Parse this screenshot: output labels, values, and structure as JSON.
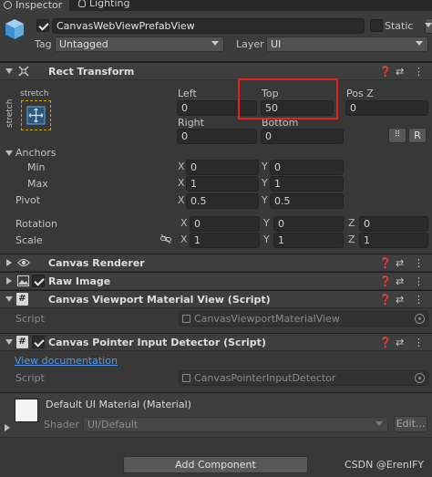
{
  "tabs": [
    {
      "label": "Inspector",
      "icon": "info-icon",
      "active": true
    },
    {
      "label": "Lighting",
      "icon": "bulb-icon",
      "active": false
    }
  ],
  "gameobject": {
    "active": true,
    "name": "CanvasWebViewPrefabView",
    "static_label": "Static",
    "tag_label": "Tag",
    "tag_value": "Untagged",
    "layer_label": "Layer",
    "layer_value": "UI"
  },
  "rect_transform": {
    "title": "Rect Transform",
    "stretch_top": "stretch",
    "stretch_side": "stretch",
    "left_label": "Left",
    "left_value": "0",
    "top_label": "Top",
    "top_value": "50",
    "posz_label": "Pos Z",
    "posz_value": "0",
    "right_label": "Right",
    "right_value": "0",
    "bottom_label": "Bottom",
    "bottom_value": "0",
    "r_button": "R",
    "anchors_label": "Anchors",
    "min_label": "Min",
    "min_x": "0",
    "min_y": "0",
    "max_label": "Max",
    "max_x": "1",
    "max_y": "1",
    "pivot_label": "Pivot",
    "pivot_x": "0.5",
    "pivot_y": "0.5",
    "rotation_label": "Rotation",
    "rot_x": "0",
    "rot_y": "0",
    "rot_z": "0",
    "scale_label": "Scale",
    "scale_x": "1",
    "scale_y": "1",
    "scale_z": "1",
    "axis_x": "X",
    "axis_y": "Y",
    "axis_z": "Z"
  },
  "components": {
    "canvas_renderer": "Canvas Renderer",
    "raw_image": "Raw Image",
    "viewport_material": {
      "title": "Canvas Viewport Material View (Script)",
      "script_label": "Script",
      "script_value": "CanvasViewportMaterialView"
    },
    "pointer_input": {
      "title": "Canvas Pointer Input Detector (Script)",
      "doc_link": "View documentation",
      "script_label": "Script",
      "script_value": "CanvasPointerInputDetector"
    }
  },
  "material": {
    "title": "Default UI Material (Material)",
    "shader_label": "Shader",
    "shader_value": "UI/Default",
    "edit_button": "Edit..."
  },
  "add_component": "Add Component",
  "watermark": "CSDN @ErenIFY",
  "colors": {
    "accent": "#3a79bb",
    "highlight": "#e8231f",
    "link": "#4f9bea"
  }
}
